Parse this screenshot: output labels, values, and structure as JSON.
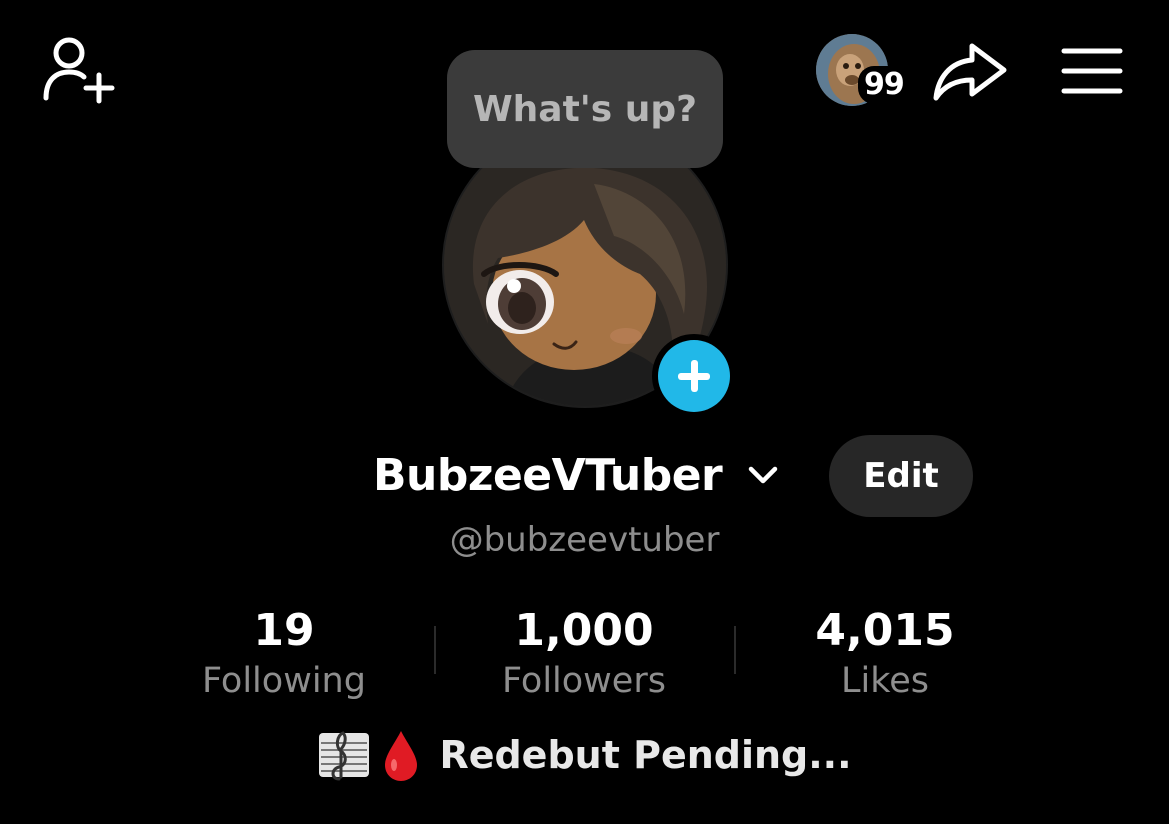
{
  "header": {
    "add_friend_icon": "person-plus-icon",
    "friend_notifications_count": "99",
    "share_icon": "share-arrow-icon",
    "menu_icon": "hamburger-menu-icon"
  },
  "status_bubble": {
    "text": "What's up?"
  },
  "profile": {
    "display_name": "BubzeeVTuber",
    "username": "@bubzeevtuber",
    "edit_label": "Edit",
    "avatar_add_icon": "plus-icon"
  },
  "stats": [
    {
      "value": "19",
      "label": "Following"
    },
    {
      "value": "1,000",
      "label": "Followers"
    },
    {
      "value": "4,015",
      "label": "Likes"
    }
  ],
  "bio": {
    "emoji_icons": [
      "music-score-icon",
      "blood-drop-icon"
    ],
    "text": "Redebut Pending..."
  },
  "colors": {
    "background": "#000000",
    "accent": "#21b8e8",
    "muted_text": "#8e8e8e",
    "bubble": "#3b3b3b",
    "edit_button": "#272727"
  }
}
